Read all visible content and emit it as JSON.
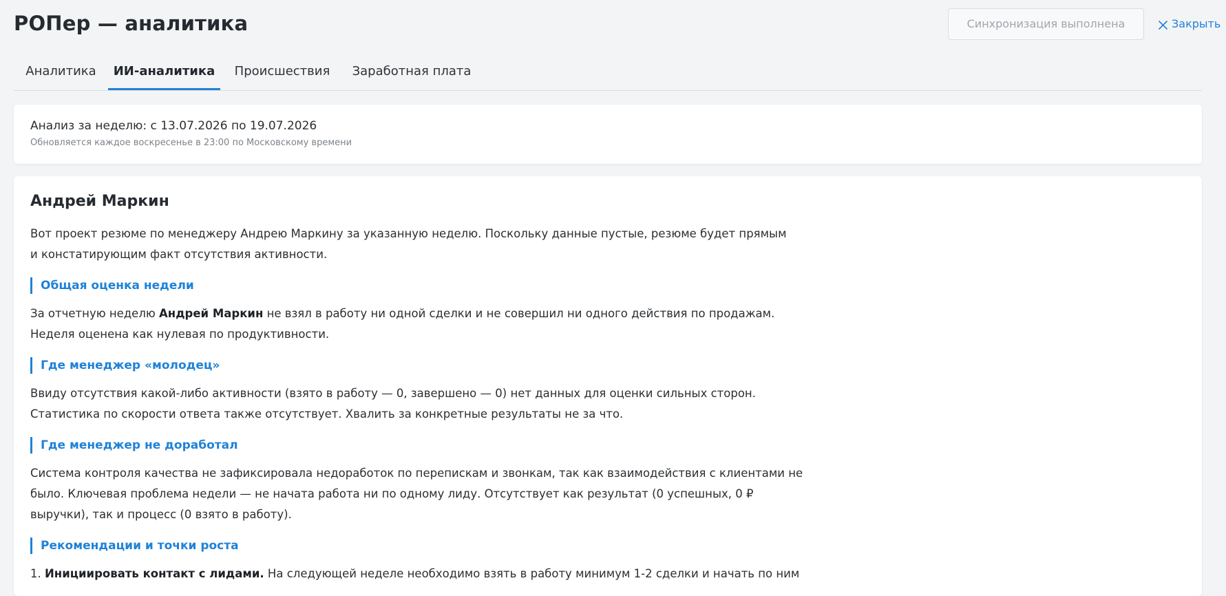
{
  "header": {
    "title": "РОПер — аналитика",
    "sync_label": "Синхронизация выполнена",
    "close_label": "Закрыть",
    "close_icon": "close-icon"
  },
  "tabs": [
    {
      "label": "Аналитика",
      "active": false
    },
    {
      "label": "ИИ-аналитика",
      "active": true
    },
    {
      "label": "Происшествия",
      "active": false
    },
    {
      "label": "Заработная плата",
      "active": false
    }
  ],
  "period": {
    "title": "Анализ за неделю: с 13.07.2026 по 19.07.2026",
    "subtitle": "Обновляется каждое воскресенье в 23:00 по Московскому времени"
  },
  "report": {
    "manager_name": "Андрей Маркин",
    "intro": {
      "line1": "Вот проект резюме по менеджеру Андрею Маркину за указанную неделю. Поскольку данные пустые, резюме будет прямым",
      "line2": "и констатирующим факт отсутствия активности."
    },
    "sections": [
      {
        "heading": "Общая оценка недели",
        "line1_before": "За отчетную неделю ",
        "line1_bold": "Андрей Маркин",
        "line1_after": " не взял в работу ни одной сделки и не совершил ни одного действия по продажам.",
        "line2": "Неделя оценена как нулевая по продуктивности."
      },
      {
        "heading": "Где менеджер «молодец»",
        "line1": "Ввиду отсутствия какой-либо активности (взято в работу — 0, завершено — 0) нет данных для оценки сильных сторон.",
        "line2": "Статистика по скорости ответа также отсутствует. Хвалить за конкретные результаты не за что."
      },
      {
        "heading": "Где менеджер не доработал",
        "line1": "Система контроля качества не зафиксировала недоработок по перепискам и звонкам, так как взаимодействия с клиентами не",
        "line2": "было. Ключевая проблема недели — не начата работа ни по одному лиду. Отсутствует как результат (0 успешных, 0 ₽",
        "line3": "выручки), так и процесс (0 взято в работу)."
      },
      {
        "heading": "Рекомендации и точки роста",
        "item1_num": "1. ",
        "item1_bold": "Инициировать контакт с лидами.",
        "item1_text": " На следующей неделе необходимо взять в работу минимум 1-2 сделки и начать по ним"
      }
    ]
  },
  "colors": {
    "accent": "#1f82d8",
    "background": "#f3f4f6",
    "card": "#ffffff"
  }
}
